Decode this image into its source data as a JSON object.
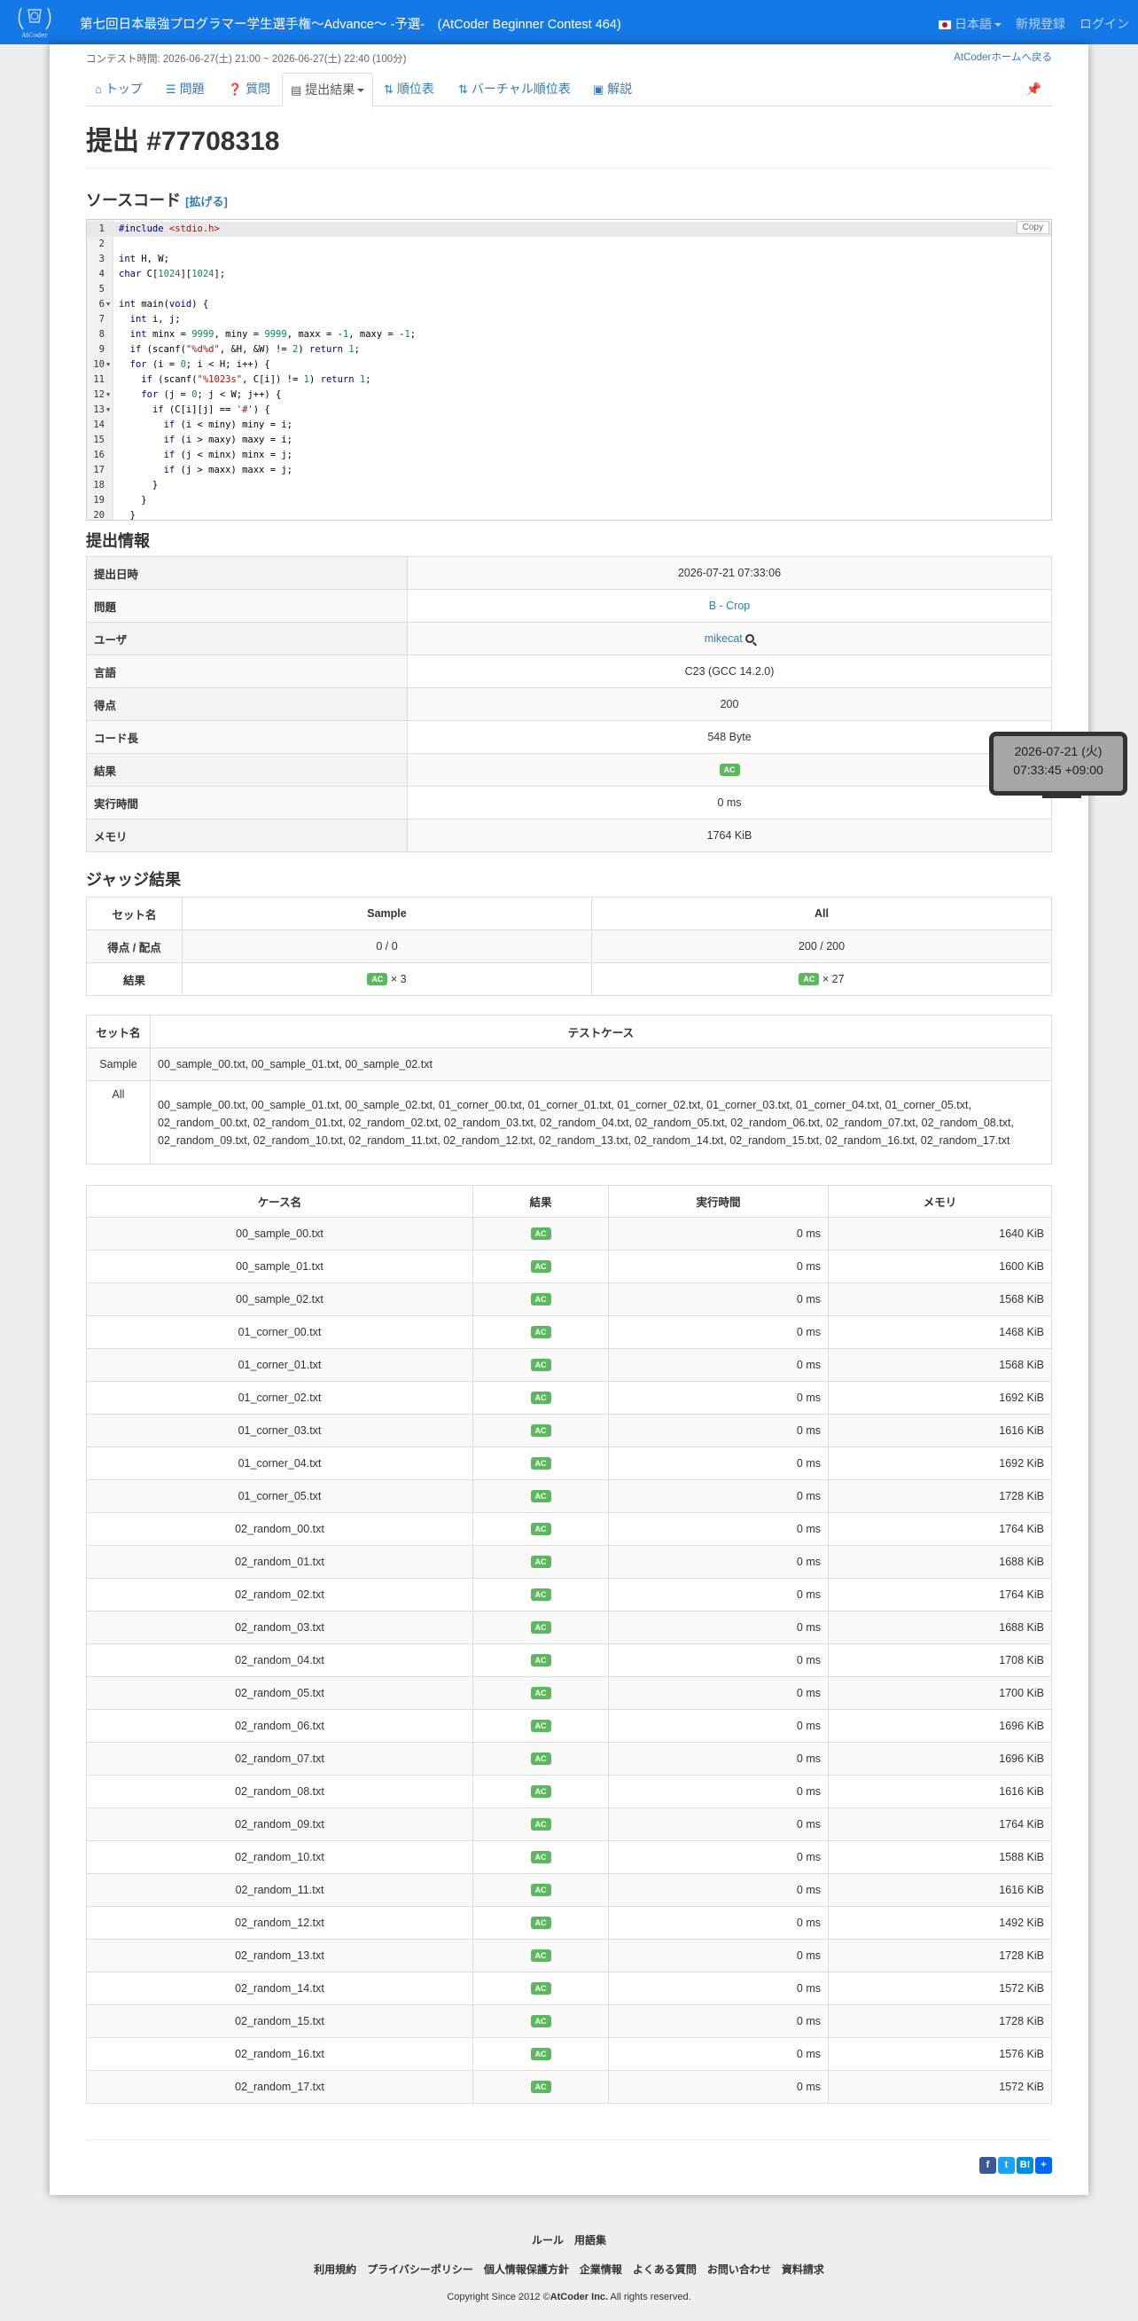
{
  "navbar": {
    "logo_text": "AtCoder",
    "contest_title": "第七回日本最強プログラマー学生選手権〜Advance〜 -予選-　(AtCoder Beginner Contest 464)",
    "lang": "日本語",
    "signup": "新規登録",
    "login": "ログイン"
  },
  "contest": {
    "time": "コンテスト時間: 2026-06-27(土) 21:00 ~ 2026-06-27(土) 22:40 (100分)",
    "home_link": "AtCoderホームへ戻る"
  },
  "tabs": [
    {
      "label": "トップ",
      "icon": "home-icon"
    },
    {
      "label": "問題",
      "icon": "list-icon"
    },
    {
      "label": "質問",
      "icon": "question-icon"
    },
    {
      "label": "提出結果",
      "icon": "table-icon"
    },
    {
      "label": "順位表",
      "icon": "sort-icon"
    },
    {
      "label": "バーチャル順位表",
      "icon": "sort-icon"
    },
    {
      "label": "解説",
      "icon": "book-icon"
    }
  ],
  "title": "提出 #77708318",
  "source": {
    "heading": "ソースコード",
    "expand": "[拡げる]",
    "copy": "Copy",
    "lines": [
      "#include <stdio.h>",
      "",
      "int H, W;",
      "char C[1024][1024];",
      "",
      "int main(void) {",
      "  int i, j;",
      "  int minx = 9999, miny = 9999, maxx = -1, maxy = -1;",
      "  if (scanf(\"%d%d\", &H, &W) != 2) return 1;",
      "  for (i = 0; i < H; i++) {",
      "    if (scanf(\"%1023s\", C[i]) != 1) return 1;",
      "    for (j = 0; j < W; j++) {",
      "      if (C[i][j] == '#') {",
      "        if (i < miny) miny = i;",
      "        if (i > maxy) maxy = i;",
      "        if (j < minx) minx = j;",
      "        if (j > maxx) maxx = j;",
      "      }",
      "    }",
      "  }"
    ],
    "line_numbers": [
      "1",
      "2",
      "3",
      "4",
      "5",
      "6",
      "7",
      "8",
      "9",
      "10",
      "11",
      "12",
      "13",
      "14",
      "15",
      "16",
      "17",
      "18",
      "19",
      "20"
    ]
  },
  "info": {
    "heading": "提出情報",
    "rows": [
      {
        "label": "提出日時",
        "value": "2026-07-21 07:33:06"
      },
      {
        "label": "問題",
        "value": "B - Crop"
      },
      {
        "label": "ユーザ",
        "value": "mikecat"
      },
      {
        "label": "言語",
        "value": "C23 (GCC 14.2.0)"
      },
      {
        "label": "得点",
        "value": "200"
      },
      {
        "label": "コード長",
        "value": "548 Byte"
      },
      {
        "label": "結果",
        "value": "AC"
      },
      {
        "label": "実行時間",
        "value": "0 ms"
      },
      {
        "label": "メモリ",
        "value": "1764 KiB"
      }
    ]
  },
  "tooltip": {
    "line1": "2026-07-21 (火)",
    "line2": "07:33:45 +09:00"
  },
  "judge": {
    "heading": "ジャッジ結果",
    "header": [
      "セット名",
      "Sample",
      "All"
    ],
    "score_label": "得点 / 配点",
    "scores": [
      "0 / 0",
      "200 / 200"
    ],
    "result_label": "結果",
    "results": [
      {
        "status": "AC",
        "count": "× 3"
      },
      {
        "status": "AC",
        "count": "× 27"
      }
    ]
  },
  "testcases": {
    "header": [
      "セット名",
      "テストケース"
    ],
    "rows": [
      {
        "name": "Sample",
        "list": "00_sample_00.txt, 00_sample_01.txt, 00_sample_02.txt"
      },
      {
        "name": "All",
        "list": "00_sample_00.txt, 00_sample_01.txt, 00_sample_02.txt, 01_corner_00.txt, 01_corner_01.txt, 01_corner_02.txt, 01_corner_03.txt, 01_corner_04.txt, 01_corner_05.txt, 02_random_00.txt, 02_random_01.txt, 02_random_02.txt, 02_random_03.txt, 02_random_04.txt, 02_random_05.txt, 02_random_06.txt, 02_random_07.txt, 02_random_08.txt, 02_random_09.txt, 02_random_10.txt, 02_random_11.txt, 02_random_12.txt, 02_random_13.txt, 02_random_14.txt, 02_random_15.txt, 02_random_16.txt, 02_random_17.txt"
      }
    ]
  },
  "cases": {
    "header": [
      "ケース名",
      "結果",
      "実行時間",
      "メモリ"
    ],
    "rows": [
      {
        "name": "00_sample_00.txt",
        "status": "AC",
        "time": "0 ms",
        "memory": "1640 KiB"
      },
      {
        "name": "00_sample_01.txt",
        "status": "AC",
        "time": "0 ms",
        "memory": "1600 KiB"
      },
      {
        "name": "00_sample_02.txt",
        "status": "AC",
        "time": "0 ms",
        "memory": "1568 KiB"
      },
      {
        "name": "01_corner_00.txt",
        "status": "AC",
        "time": "0 ms",
        "memory": "1468 KiB"
      },
      {
        "name": "01_corner_01.txt",
        "status": "AC",
        "time": "0 ms",
        "memory": "1568 KiB"
      },
      {
        "name": "01_corner_02.txt",
        "status": "AC",
        "time": "0 ms",
        "memory": "1692 KiB"
      },
      {
        "name": "01_corner_03.txt",
        "status": "AC",
        "time": "0 ms",
        "memory": "1616 KiB"
      },
      {
        "name": "01_corner_04.txt",
        "status": "AC",
        "time": "0 ms",
        "memory": "1692 KiB"
      },
      {
        "name": "01_corner_05.txt",
        "status": "AC",
        "time": "0 ms",
        "memory": "1728 KiB"
      },
      {
        "name": "02_random_00.txt",
        "status": "AC",
        "time": "0 ms",
        "memory": "1764 KiB"
      },
      {
        "name": "02_random_01.txt",
        "status": "AC",
        "time": "0 ms",
        "memory": "1688 KiB"
      },
      {
        "name": "02_random_02.txt",
        "status": "AC",
        "time": "0 ms",
        "memory": "1764 KiB"
      },
      {
        "name": "02_random_03.txt",
        "status": "AC",
        "time": "0 ms",
        "memory": "1688 KiB"
      },
      {
        "name": "02_random_04.txt",
        "status": "AC",
        "time": "0 ms",
        "memory": "1708 KiB"
      },
      {
        "name": "02_random_05.txt",
        "status": "AC",
        "time": "0 ms",
        "memory": "1700 KiB"
      },
      {
        "name": "02_random_06.txt",
        "status": "AC",
        "time": "0 ms",
        "memory": "1696 KiB"
      },
      {
        "name": "02_random_07.txt",
        "status": "AC",
        "time": "0 ms",
        "memory": "1696 KiB"
      },
      {
        "name": "02_random_08.txt",
        "status": "AC",
        "time": "0 ms",
        "memory": "1616 KiB"
      },
      {
        "name": "02_random_09.txt",
        "status": "AC",
        "time": "0 ms",
        "memory": "1764 KiB"
      },
      {
        "name": "02_random_10.txt",
        "status": "AC",
        "time": "0 ms",
        "memory": "1588 KiB"
      },
      {
        "name": "02_random_11.txt",
        "status": "AC",
        "time": "0 ms",
        "memory": "1616 KiB"
      },
      {
        "name": "02_random_12.txt",
        "status": "AC",
        "time": "0 ms",
        "memory": "1492 KiB"
      },
      {
        "name": "02_random_13.txt",
        "status": "AC",
        "time": "0 ms",
        "memory": "1728 KiB"
      },
      {
        "name": "02_random_14.txt",
        "status": "AC",
        "time": "0 ms",
        "memory": "1572 KiB"
      },
      {
        "name": "02_random_15.txt",
        "status": "AC",
        "time": "0 ms",
        "memory": "1728 KiB"
      },
      {
        "name": "02_random_16.txt",
        "status": "AC",
        "time": "0 ms",
        "memory": "1576 KiB"
      },
      {
        "name": "02_random_17.txt",
        "status": "AC",
        "time": "0 ms",
        "memory": "1572 KiB"
      }
    ]
  },
  "share": [
    {
      "icon": "facebook-icon",
      "glyph": "f",
      "color": "#3b5998"
    },
    {
      "icon": "twitter-icon",
      "glyph": "t",
      "color": "#1da1f2"
    },
    {
      "icon": "hatena-icon",
      "glyph": "B!",
      "color": "#008fde"
    },
    {
      "icon": "share-plus-icon",
      "glyph": "+",
      "color": "#0166ff"
    }
  ],
  "footer": {
    "row1": [
      "ルール",
      "用語集"
    ],
    "row2": [
      "利用規約",
      "プライバシーポリシー",
      "個人情報保護方針",
      "企業情報",
      "よくある質問",
      "お問い合わせ",
      "資料請求"
    ],
    "copyright_prefix": "Copyright Since 2012 ©",
    "copyright_company": "AtCoder Inc.",
    "copyright_suffix": " All rights reserved."
  },
  "colors": {
    "brand": "#1478e6",
    "link": "#337ab7",
    "ac": "#5cb85c"
  }
}
